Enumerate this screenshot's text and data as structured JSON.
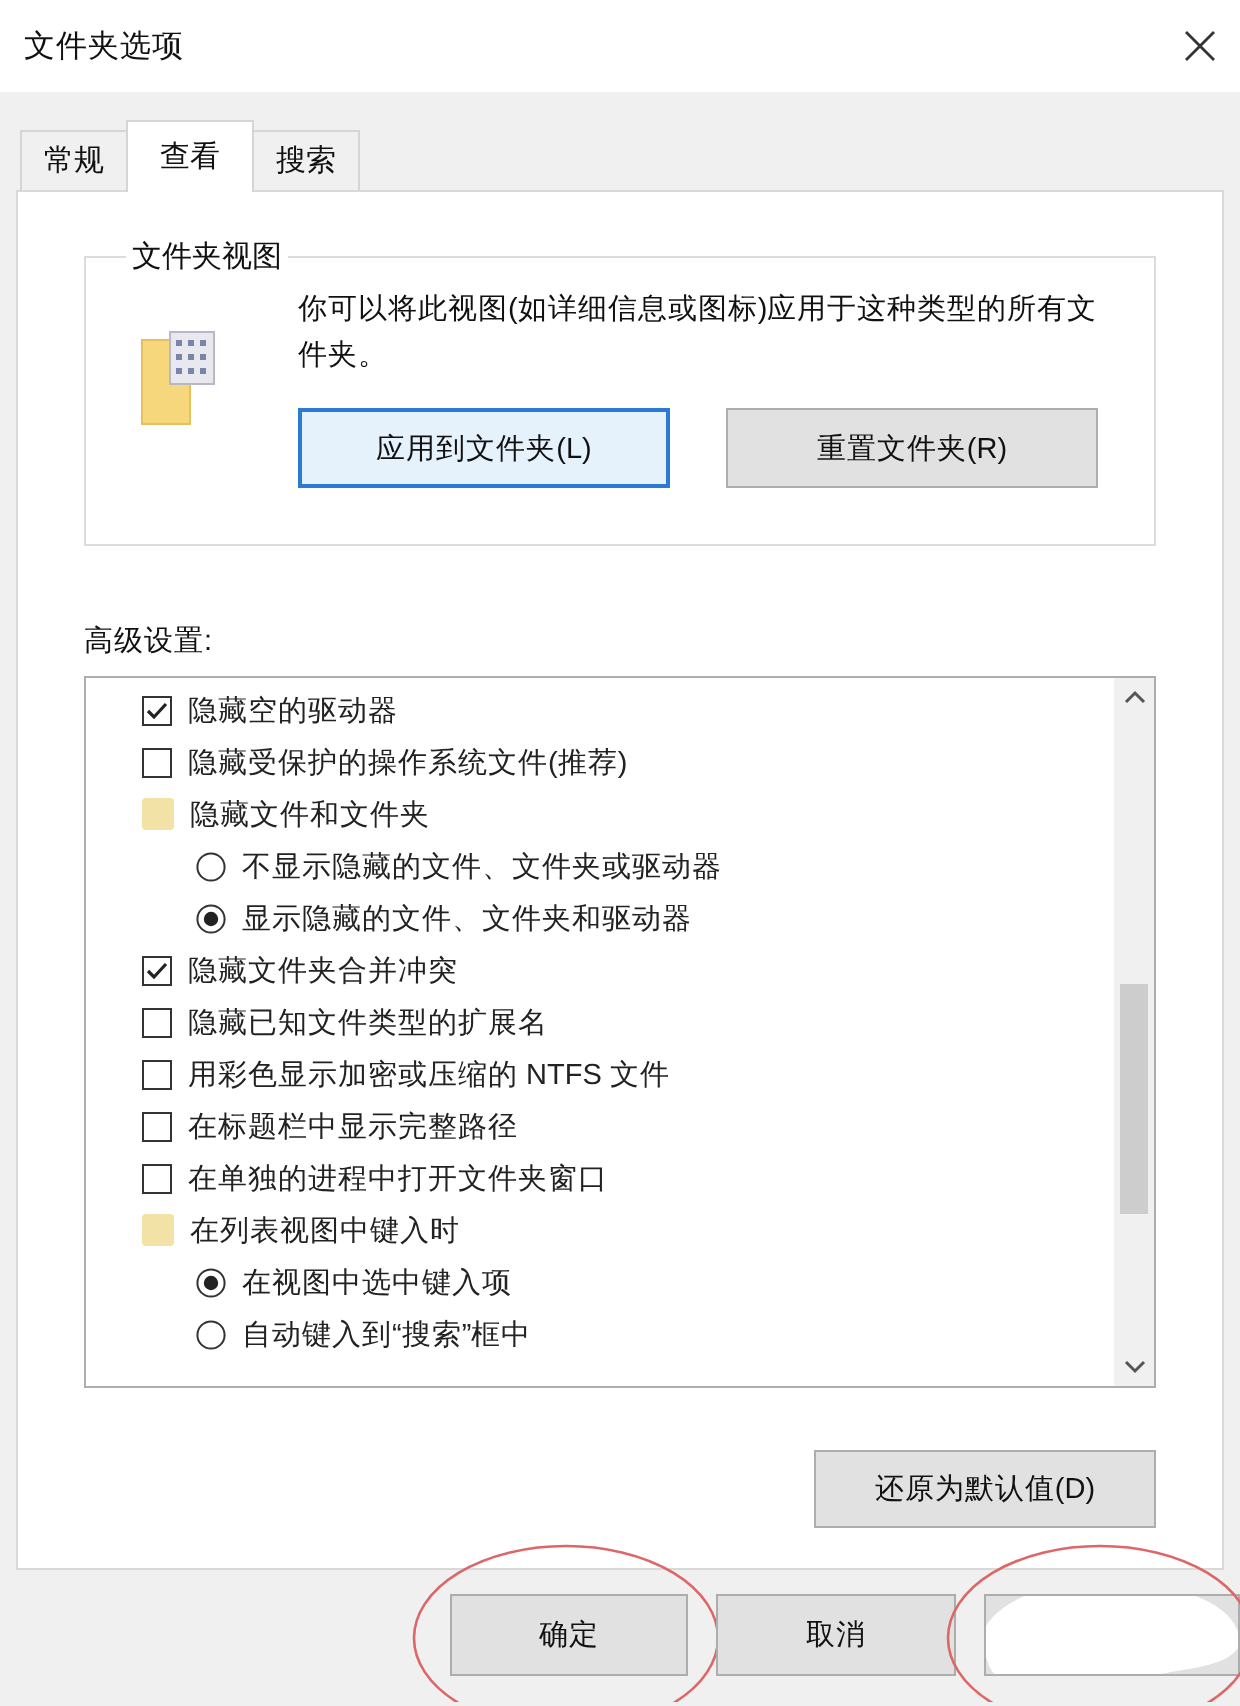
{
  "window": {
    "title": "文件夹选项"
  },
  "tabs": [
    {
      "label": "常规",
      "selected": false
    },
    {
      "label": "查看",
      "selected": true
    },
    {
      "label": "搜索",
      "selected": false
    }
  ],
  "folder_views": {
    "title": "文件夹视图",
    "description": "你可以将此视图(如详细信息或图标)应用于这种类型的所有文件夹。",
    "buttons": [
      {
        "label": "应用到文件夹(L)",
        "focused": true
      },
      {
        "label": "重置文件夹(R)",
        "focused": false
      }
    ]
  },
  "advanced": {
    "label": "高级设置:",
    "items": [
      {
        "kind": "checkbox",
        "label": "隐藏空的驱动器",
        "checked": true
      },
      {
        "kind": "checkbox",
        "label": "隐藏受保护的操作系统文件(推荐)",
        "checked": false
      },
      {
        "kind": "group",
        "label": "隐藏文件和文件夹",
        "children": [
          {
            "kind": "radio",
            "label": "不显示隐藏的文件、文件夹或驱动器",
            "selected": false
          },
          {
            "kind": "radio",
            "label": "显示隐藏的文件、文件夹和驱动器",
            "selected": true
          }
        ]
      },
      {
        "kind": "checkbox",
        "label": "隐藏文件夹合并冲突",
        "checked": true
      },
      {
        "kind": "checkbox",
        "label": "隐藏已知文件类型的扩展名",
        "checked": false
      },
      {
        "kind": "checkbox",
        "label": "用彩色显示加密或压缩的 NTFS 文件",
        "checked": false
      },
      {
        "kind": "checkbox",
        "label": "在标题栏中显示完整路径",
        "checked": false
      },
      {
        "kind": "checkbox",
        "label": "在单独的进程中打开文件夹窗口",
        "checked": false
      },
      {
        "kind": "group",
        "label": "在列表视图中键入时",
        "children": [
          {
            "kind": "radio",
            "label": "在视图中选中键入项",
            "selected": true
          },
          {
            "kind": "radio",
            "label": "自动键入到“搜索”框中",
            "selected": false
          }
        ]
      }
    ]
  },
  "restore_button": "还原为默认值(D)",
  "buttons": [
    {
      "kind": "button",
      "label": "确定",
      "circled": true
    },
    {
      "kind": "button",
      "label": "取消",
      "circled": false
    },
    {
      "kind": "obscured",
      "circled": true
    }
  ]
}
